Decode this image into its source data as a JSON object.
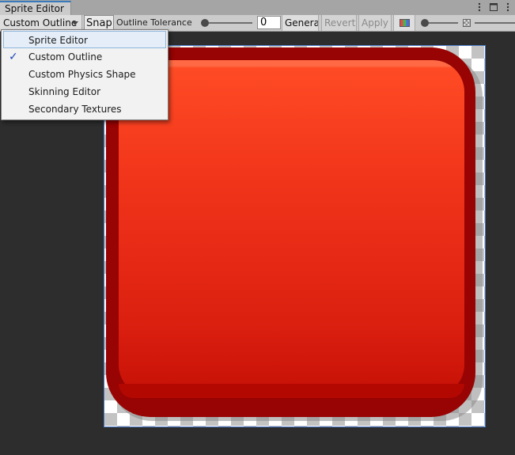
{
  "window": {
    "tab_title": "Sprite Editor"
  },
  "toolbar": {
    "mode_selected": "Custom Outline",
    "snap_label": "Snap",
    "outline_tolerance_label": "Outline Tolerance",
    "outline_tolerance_value": "0",
    "generate_label": "Generate",
    "revert_label": "Revert",
    "apply_label": "Apply"
  },
  "menu": {
    "items": [
      {
        "label": "Sprite Editor",
        "checked": false,
        "hovered": true
      },
      {
        "label": "Custom Outline",
        "checked": true,
        "hovered": false
      },
      {
        "label": "Custom Physics Shape",
        "checked": false,
        "hovered": false
      },
      {
        "label": "Skinning Editor",
        "checked": false,
        "hovered": false
      },
      {
        "label": "Secondary Textures",
        "checked": false,
        "hovered": false
      }
    ],
    "check_glyph": "✓"
  },
  "icons": {
    "kebab": "⋮",
    "maximize": "□",
    "color_channels": "color-channels-icon",
    "alpha_checker": "alpha-checker-icon"
  },
  "colors": {
    "accent": "#3a79bb",
    "sprite_red": "#f2361b",
    "sprite_dark": "#980303"
  }
}
